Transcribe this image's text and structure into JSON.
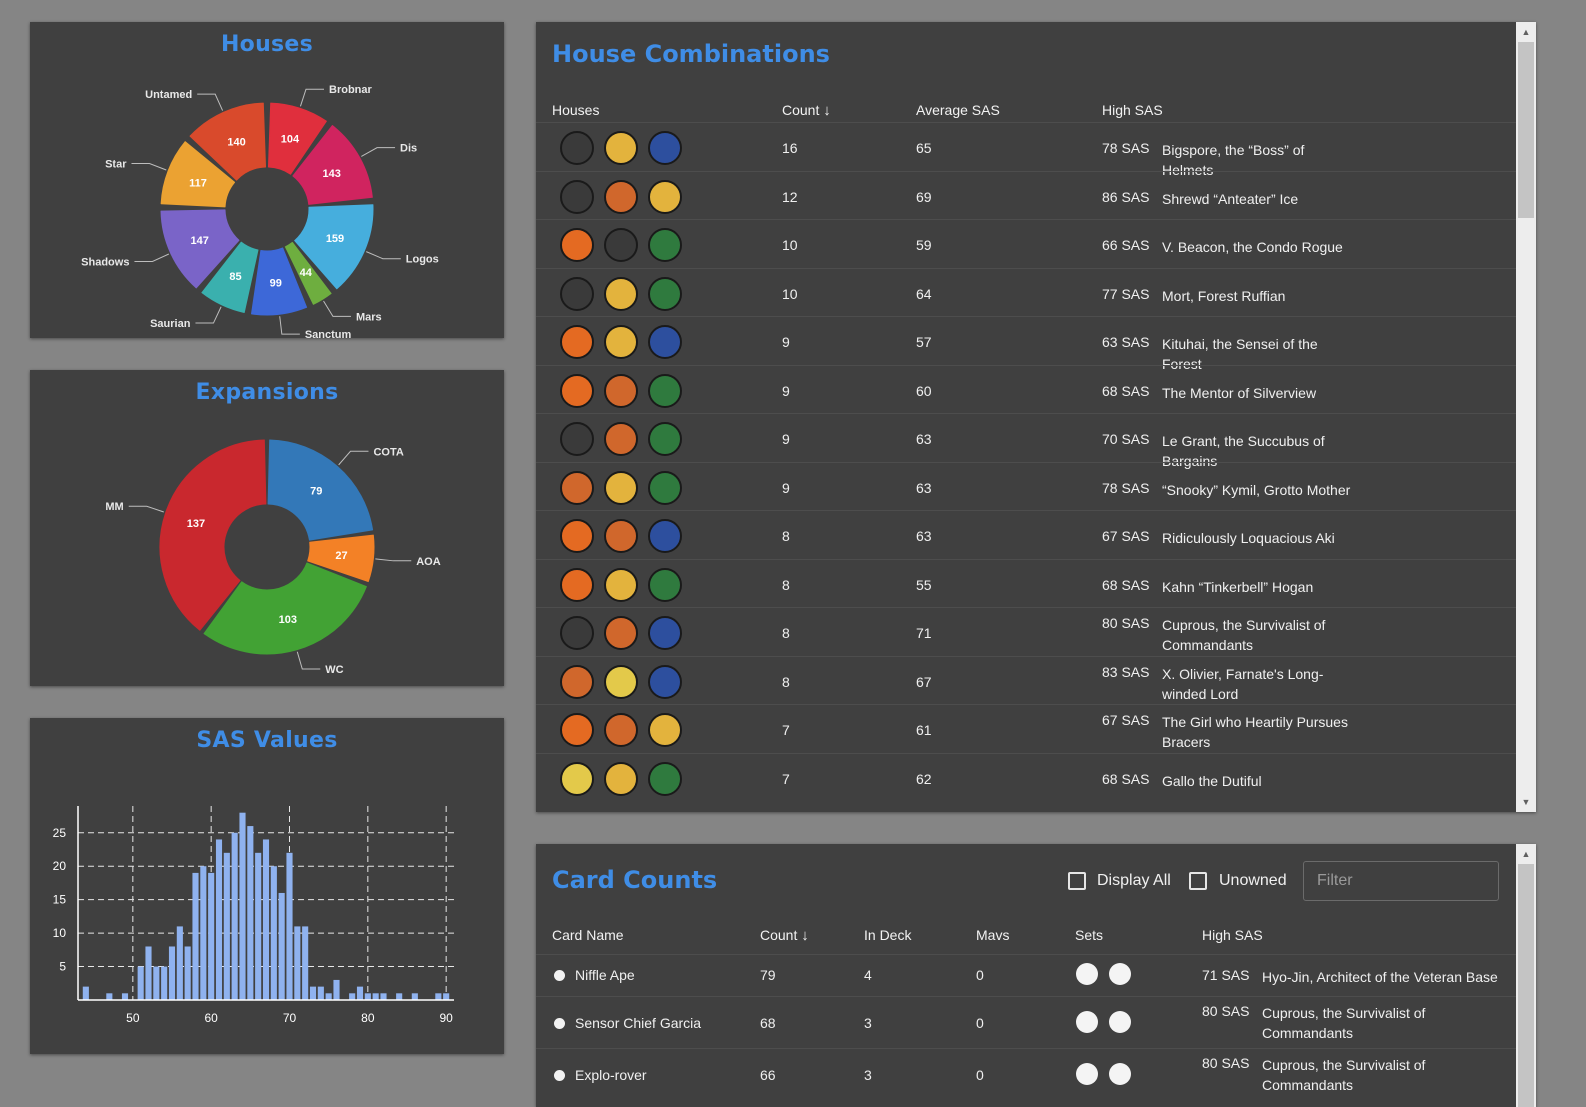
{
  "houses_chart": {
    "title": "Houses",
    "chart_data": {
      "type": "pie",
      "title": "Houses",
      "categories": [
        "Brobnar",
        "Dis",
        "Logos",
        "Mars",
        "Sanctum",
        "Saurian",
        "Shadows",
        "Star",
        "Untamed"
      ],
      "values": [
        104,
        143,
        159,
        44,
        99,
        85,
        147,
        117,
        140
      ],
      "colors": [
        "#e02f3d",
        "#d0245f",
        "#46aedd",
        "#6eae3f",
        "#3d68d8",
        "#3ab0ae",
        "#7a64c8",
        "#eba232",
        "#d94a2c"
      ]
    }
  },
  "expansions_chart": {
    "title": "Expansions",
    "chart_data": {
      "type": "pie",
      "title": "Expansions",
      "categories": [
        "COTA",
        "AOA",
        "WC",
        "MM"
      ],
      "values": [
        79,
        27,
        103,
        137
      ],
      "colors": [
        "#3378b8",
        "#f38126",
        "#42a234",
        "#c9282e"
      ]
    }
  },
  "sas_chart": {
    "title": "SAS Values",
    "chart_data": {
      "type": "bar",
      "title": "SAS Values",
      "x": [
        44,
        47,
        49,
        51,
        52,
        53,
        54,
        55,
        56,
        57,
        58,
        59,
        60,
        61,
        62,
        63,
        64,
        65,
        66,
        67,
        68,
        69,
        70,
        71,
        72,
        73,
        74,
        75,
        76,
        78,
        79,
        80,
        81,
        82,
        84,
        86,
        89,
        90
      ],
      "values": [
        2,
        1,
        1,
        5,
        8,
        5,
        5,
        8,
        11,
        8,
        19,
        20,
        19,
        24,
        22,
        25,
        28,
        26,
        22,
        24,
        20,
        16,
        22,
        11,
        11,
        2,
        2,
        1,
        3,
        1,
        2,
        1,
        1,
        1,
        1,
        1,
        1,
        1
      ],
      "xlim": [
        43,
        91
      ],
      "ylim": [
        0,
        29
      ],
      "xticks": [
        50,
        60,
        70,
        80,
        90
      ],
      "yticks": [
        5,
        10,
        15,
        20,
        25
      ],
      "grid": true,
      "color": "#8fb2ef"
    }
  },
  "house_combinations": {
    "title": "House Combinations",
    "columns": {
      "houses": "Houses",
      "count": "Count",
      "count_sort_icon": "↓",
      "average": "Average SAS",
      "high": "High SAS"
    },
    "rows": [
      {
        "houses": [
          "dis",
          "sanctum",
          "star-alliance"
        ],
        "count": "16",
        "average": "65",
        "high_sas": "78 SAS",
        "deck": "Bigspore, the “Boss” of Helmets"
      },
      {
        "houses": [
          "dis",
          "logos",
          "sanctum"
        ],
        "count": "12",
        "average": "69",
        "high_sas": "86 SAS",
        "deck": "Shrewd “Anteater” Ice"
      },
      {
        "houses": [
          "brobnar",
          "dis",
          "untamed"
        ],
        "count": "10",
        "average": "59",
        "high_sas": "66 SAS",
        "deck": "V. Beacon, the Condo Rogue"
      },
      {
        "houses": [
          "dis",
          "sanctum",
          "untamed"
        ],
        "count": "10",
        "average": "64",
        "high_sas": "77 SAS",
        "deck": "Mort, Forest Ruffian"
      },
      {
        "houses": [
          "brobnar",
          "sanctum",
          "star-alliance"
        ],
        "count": "9",
        "average": "57",
        "high_sas": "63 SAS",
        "deck": "Kituhai, the Sensei of the Forest"
      },
      {
        "houses": [
          "brobnar",
          "logos",
          "untamed"
        ],
        "count": "9",
        "average": "60",
        "high_sas": "68 SAS",
        "deck": "The Mentor of Silverview"
      },
      {
        "houses": [
          "dis",
          "logos",
          "untamed"
        ],
        "count": "9",
        "average": "63",
        "high_sas": "70 SAS",
        "deck": "Le Grant, the Succubus of Bargains"
      },
      {
        "houses": [
          "logos",
          "sanctum",
          "untamed"
        ],
        "count": "9",
        "average": "63",
        "high_sas": "78 SAS",
        "deck": "“Snooky” Kymil, Grotto Mother"
      },
      {
        "houses": [
          "brobnar",
          "logos",
          "star-alliance"
        ],
        "count": "8",
        "average": "63",
        "high_sas": "67 SAS",
        "deck": "Ridiculously Loquacious Aki"
      },
      {
        "houses": [
          "brobnar",
          "sanctum",
          "untamed"
        ],
        "count": "8",
        "average": "55",
        "high_sas": "68 SAS",
        "deck": "Kahn “Tinkerbell” Hogan"
      },
      {
        "houses": [
          "dis",
          "logos",
          "star-alliance"
        ],
        "count": "8",
        "average": "71",
        "high_sas": "80 SAS",
        "deck": "Cuprous, the Survivalist of Commandants"
      },
      {
        "houses": [
          "logos",
          "saurian",
          "star-alliance"
        ],
        "count": "8",
        "average": "67",
        "high_sas": "83 SAS",
        "deck": "X. Olivier, Farnate's Long-winded Lord"
      },
      {
        "houses": [
          "brobnar",
          "logos",
          "sanctum"
        ],
        "count": "7",
        "average": "61",
        "high_sas": "67 SAS",
        "deck": "The Girl who Heartily Pursues Bracers"
      },
      {
        "houses": [
          "saurian",
          "sanctum",
          "untamed"
        ],
        "count": "7",
        "average": "62",
        "high_sas": "68 SAS",
        "deck": "Gallo the Dutiful"
      }
    ]
  },
  "card_counts": {
    "title": "Card Counts",
    "display_all_label": "Display All",
    "unowned_label": "Unowned",
    "filter_placeholder": "Filter",
    "columns": {
      "name": "Card Name",
      "count": "Count",
      "count_sort_icon": "↓",
      "in_deck": "In Deck",
      "mavs": "Mavs",
      "sets": "Sets",
      "high": "High SAS"
    },
    "rows": [
      {
        "name": "Niffle Ape",
        "count": "79",
        "in_deck": "4",
        "mavs": "0",
        "sets": [
          "cota-set-icon",
          "wc-set-icon"
        ],
        "high_sas": "71 SAS",
        "deck": "Hyo-Jin, Architect of the Veteran Base"
      },
      {
        "name": "Sensor Chief Garcia",
        "count": "68",
        "in_deck": "3",
        "mavs": "0",
        "sets": [
          "mm-set-icon",
          "wc-set-icon"
        ],
        "high_sas": "80 SAS",
        "deck": "Cuprous, the Survivalist of Commandants"
      },
      {
        "name": "Explo-rover",
        "count": "66",
        "in_deck": "3",
        "mavs": "0",
        "sets": [
          "mm-set-icon",
          "wc-set-icon"
        ],
        "high_sas": "80 SAS",
        "deck": "Cuprous, the Survivalist of Commandants"
      }
    ]
  },
  "house_icon_colors": {
    "dis": "#3a3a3a",
    "sanctum": "#e3b33d",
    "star-alliance": "#2d4f9e",
    "logos": "#d0672c",
    "brobnar": "#e46a22",
    "untamed": "#2f7a3e",
    "saurian": "#e3c94a"
  }
}
